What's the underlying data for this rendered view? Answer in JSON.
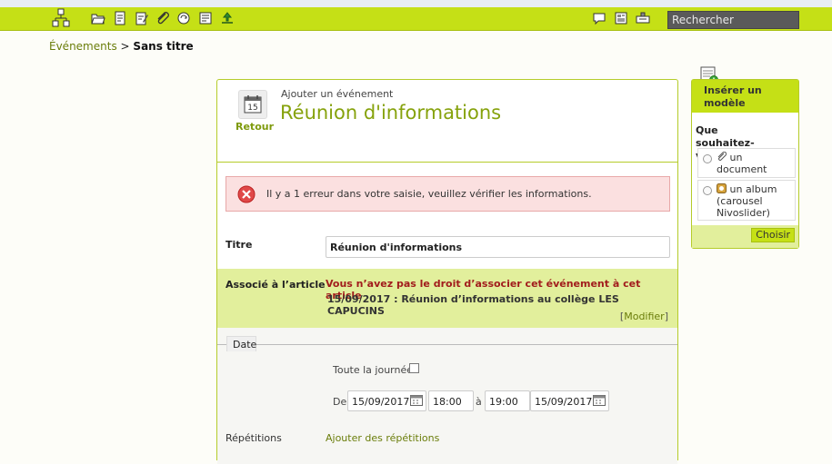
{
  "colors": {
    "accent": "#c5e016",
    "accent_text": "#86a20c",
    "link": "#6a7d0a",
    "error_bg": "#fbe0e0",
    "error_text": "#a11c1c",
    "assoc_bg": "#e2ef9c"
  },
  "toolbar": {
    "icons": [
      "sitemap-icon",
      "folder-open-icon",
      "document-icon",
      "document-edit-icon",
      "attachment-icon",
      "refresh-icon",
      "form-icon",
      "upload-icon",
      "comments-icon",
      "news-icon",
      "mailbox-icon"
    ],
    "search_placeholder": "Rechercher"
  },
  "breadcrumb": {
    "parent": "Événements",
    "separator": ">",
    "current": "Sans titre"
  },
  "header": {
    "back_label": "Retour",
    "subtitle": "Ajouter un événement",
    "title": "Réunion d'informations",
    "calendar_day": "15"
  },
  "error": {
    "message": "Il y a 1 erreur dans votre saisie, veuillez vérifier les informations."
  },
  "form": {
    "titre_label": "Titre",
    "titre_value": "Réunion d'informations",
    "assoc_label": "Associé à l’article",
    "assoc_warning": "Vous n’avez pas le droit d’associer cet événement à cet article",
    "assoc_article": "15/09/2017 : Réunion d’informations au collège LES CAPUCINS",
    "assoc_modify_open": "[",
    "assoc_modify": "Modifier",
    "assoc_modify_close": "]",
    "date_tab": "Date",
    "all_day_label": "Toute la journée",
    "de_label": "De",
    "start_date": "15/09/2017",
    "start_time": "18:00",
    "a_label": "à",
    "end_time": "19:00",
    "end_date": "15/09/2017",
    "repetitions_label": "Répétitions",
    "repetitions_link": "Ajouter des répétitions"
  },
  "sidebar": {
    "title": "Insérer un modèle",
    "question": "Que souhaitez-vous insérer ?",
    "option1": "un document",
    "option2": "un album (carousel Nivoslider)",
    "button": "Choisir"
  }
}
